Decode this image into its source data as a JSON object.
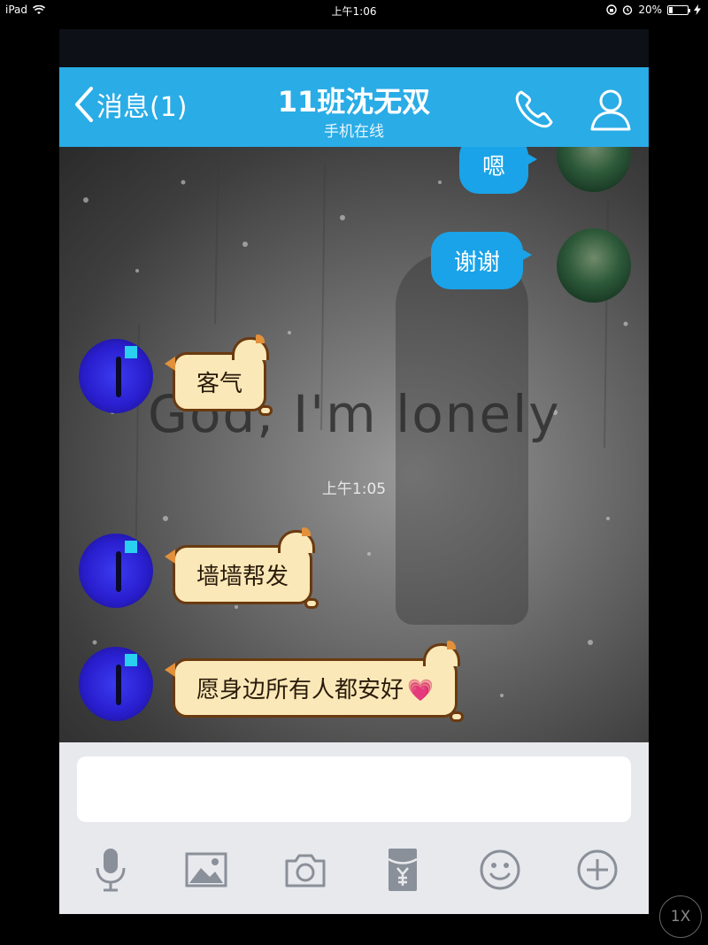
{
  "status_bar": {
    "device": "iPad",
    "time": "上午1:06",
    "battery": "20%",
    "battery_level": 0.2
  },
  "nav": {
    "back_label": "消息(1)",
    "title": "11班沈无双",
    "subtitle": "手机在线"
  },
  "chat": {
    "background_text": "God, I'm lonely",
    "timestamp": "上午1:05",
    "messages": [
      {
        "sender": "self",
        "text": "嗯"
      },
      {
        "sender": "self",
        "text": "谢谢"
      },
      {
        "sender": "peer",
        "text": "客气"
      },
      {
        "sender": "peer",
        "text": "墙墙帮发"
      },
      {
        "sender": "peer",
        "text": "愿身边所有人都安好",
        "emoji": "💗"
      }
    ]
  },
  "input": {
    "toolbar_icons": [
      "microphone-icon",
      "image-icon",
      "camera-icon",
      "red-packet-icon",
      "emoji-icon",
      "plus-icon"
    ]
  },
  "overlay": {
    "zoom_label": "1X"
  },
  "colors": {
    "nav_bar": "#2aace6",
    "outgoing_bubble": "#1aa3e8",
    "incoming_bubble": "#fbe8b8",
    "input_bar": "#e8e9ed"
  }
}
